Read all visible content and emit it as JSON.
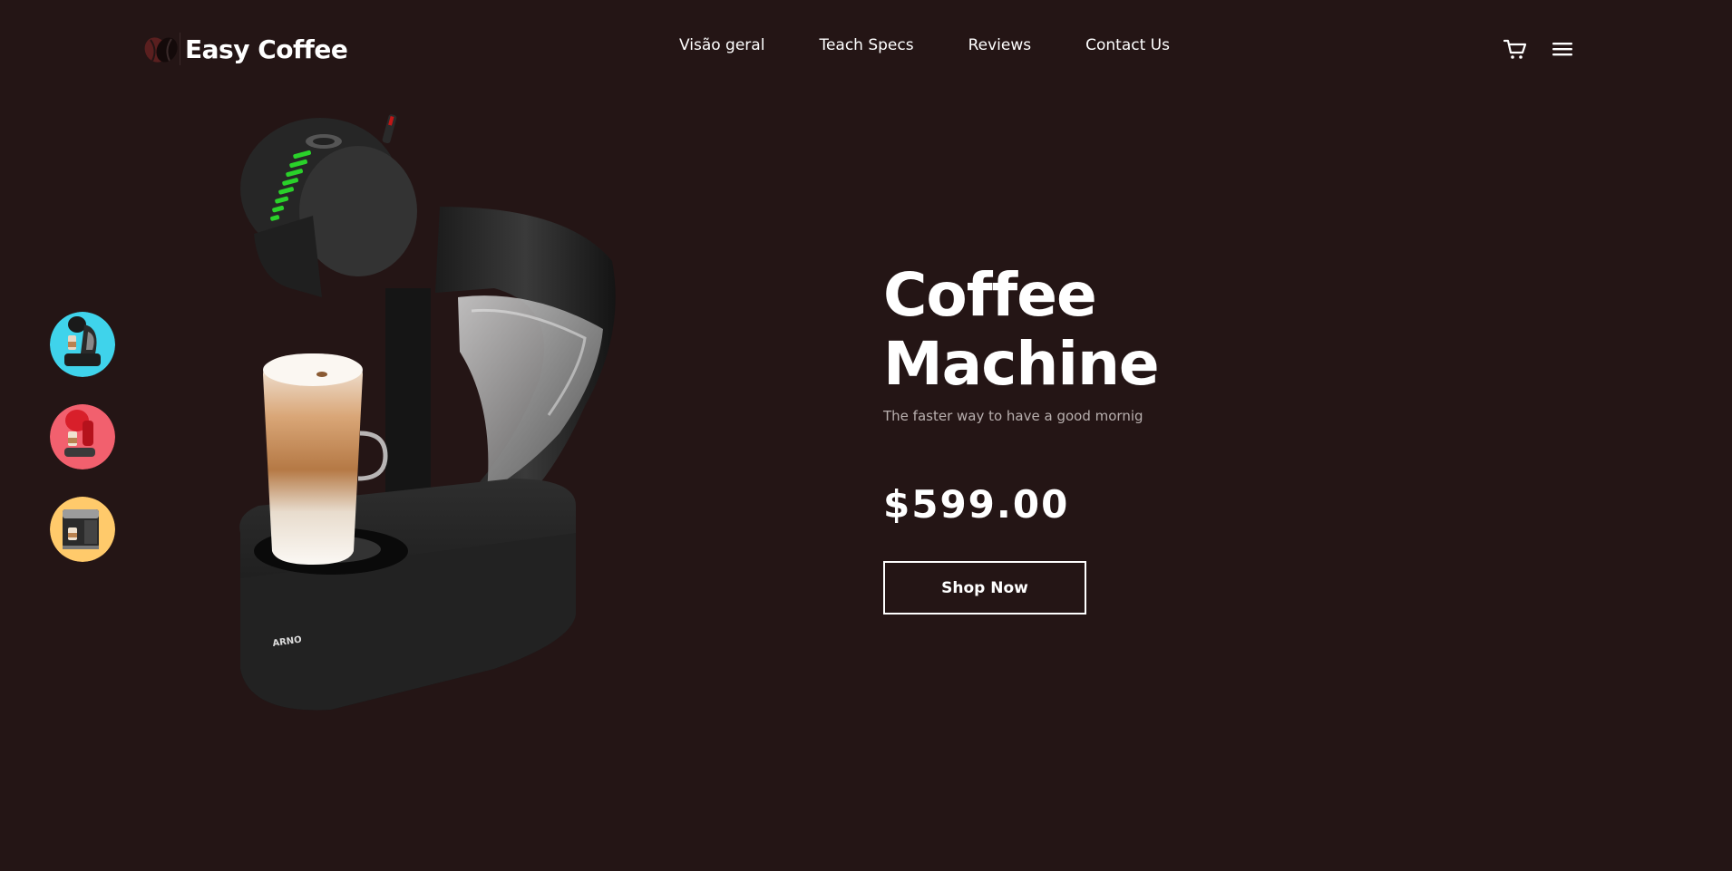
{
  "brand": {
    "name": "Easy Coffee",
    "logo_icon": "coffee-beans-icon"
  },
  "nav": {
    "items": [
      {
        "label": "Visão geral"
      },
      {
        "label": "Teach Specs"
      },
      {
        "label": "Reviews"
      },
      {
        "label": "Contact Us"
      }
    ]
  },
  "header_icons": {
    "cart": "cart-icon",
    "menu": "menu-icon"
  },
  "thumbnails": [
    {
      "name": "black coffee machine",
      "bg_color": "#3fd3eb"
    },
    {
      "name": "red coffee machine",
      "bg_color": "#f2606e"
    },
    {
      "name": "steel coffee machine",
      "bg_color": "#ffca6b"
    }
  ],
  "hero": {
    "title_line1": "Coffee",
    "title_line2": "Machine",
    "subtitle": "The faster way to have a good mornig",
    "price": "$599.00",
    "cta_label": "Shop Now",
    "product_label": "ARNO"
  },
  "colors": {
    "background": "#241515",
    "text": "#ffffff",
    "subtitle": "#b8afae",
    "led_green": "#2ad12a"
  }
}
